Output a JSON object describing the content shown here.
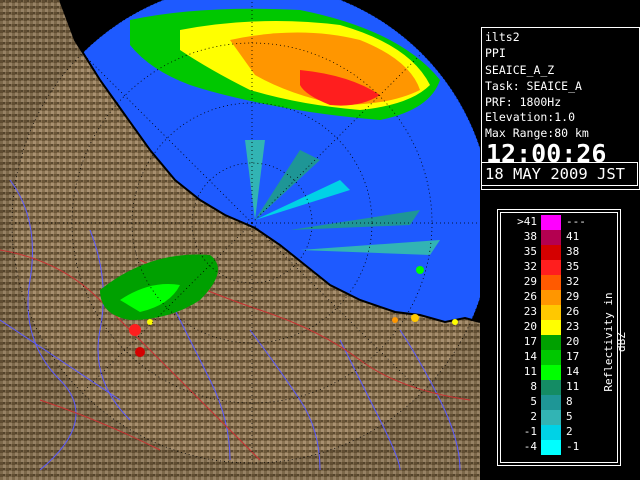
{
  "panel": {
    "radar_name": "ilts2",
    "scan_type": "PPI",
    "product": "SEAICE_A_Z",
    "task": "Task: SEAICE_A",
    "prf": "PRF: 1800Hz",
    "elevation": "Elevation:1.0",
    "max_range": "Max Range:80 km",
    "time": "12:00:26",
    "date": "18 MAY 2009 JST"
  },
  "legend": {
    "title": "Reflectivity in dBZ",
    "rows": [
      {
        "low": ">41",
        "high": "---",
        "color": "#ff00ff"
      },
      {
        "low": "38",
        "high": "41",
        "color": "#b40050"
      },
      {
        "low": "35",
        "high": "38",
        "color": "#d40000"
      },
      {
        "low": "32",
        "high": "35",
        "color": "#ff1e1e"
      },
      {
        "low": "29",
        "high": "32",
        "color": "#ff5a00"
      },
      {
        "low": "26",
        "high": "29",
        "color": "#ff9600"
      },
      {
        "low": "23",
        "high": "26",
        "color": "#ffc800"
      },
      {
        "low": "20",
        "high": "23",
        "color": "#ffff00"
      },
      {
        "low": "17",
        "high": "20",
        "color": "#00a000"
      },
      {
        "low": "14",
        "high": "17",
        "color": "#00c800"
      },
      {
        "low": "11",
        "high": "14",
        "color": "#00ff00"
      },
      {
        "low": "8",
        "high": "11",
        "color": "#148c64"
      },
      {
        "low": "5",
        "high": "8",
        "color": "#1e9696"
      },
      {
        "low": "2",
        "high": "5",
        "color": "#32b4b4"
      },
      {
        "low": "-1",
        "high": "2",
        "color": "#00d2e6"
      },
      {
        "low": "-4",
        "high": "-1",
        "color": "#00ffff"
      }
    ]
  },
  "colors": {
    "sea_echo": "#1e5aff",
    "land": "#8c7350",
    "range_rings": "#000000",
    "coastline": "#000000",
    "rivers": "#5a5aff",
    "boundaries": "#c83232"
  }
}
